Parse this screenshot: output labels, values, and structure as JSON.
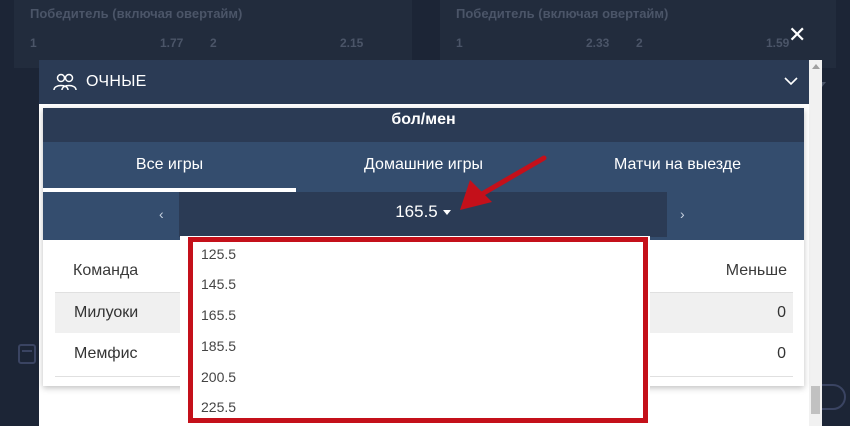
{
  "background": {
    "left_card": {
      "title": "Победитель (включая овертайм)",
      "odds": [
        "1",
        "1.77",
        "2",
        "2.15"
      ]
    },
    "right_card": {
      "title": "Победитель (включая овертайм)",
      "odds": [
        "1",
        "2.33",
        "2",
        "1.59"
      ]
    }
  },
  "modal": {
    "close_symbol": "✕",
    "header_title": "ОЧНЫЕ",
    "panel_title": "бол/мен",
    "tabs": [
      {
        "label": "Все игры",
        "active": true
      },
      {
        "label": "Домашние игры",
        "active": false
      },
      {
        "label": "Матчи на выезде",
        "active": false
      }
    ],
    "selector": {
      "prev": "‹",
      "next": "›",
      "value": "165.5"
    },
    "table": {
      "headers": {
        "team": "Команда",
        "under": "Меньше"
      },
      "rows": [
        {
          "team": "Милуоки",
          "under": "0"
        },
        {
          "team": "Мемфис",
          "under": "0"
        }
      ]
    },
    "dropdown_options": [
      "125.5",
      "145.5",
      "165.5",
      "185.5",
      "200.5",
      "225.5"
    ]
  },
  "colors": {
    "modal_header": "#2b3b55",
    "tabs_bg": "#344d6e",
    "highlight": "#c4101a"
  }
}
